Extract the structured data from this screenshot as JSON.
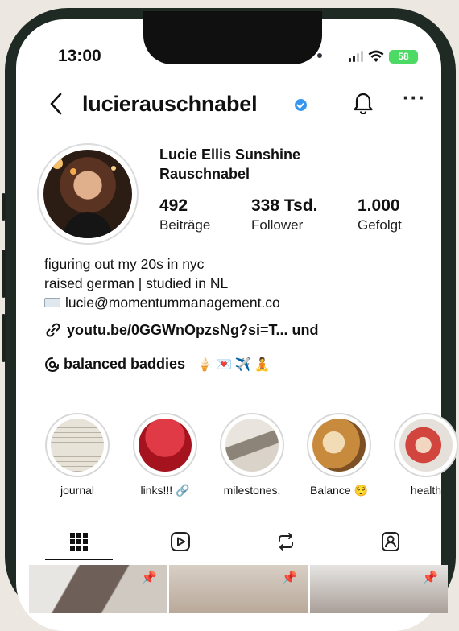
{
  "status_bar": {
    "time": "13:00",
    "battery": "58"
  },
  "header": {
    "username": "luciерauschnabel"
  },
  "profile": {
    "full_name": "Lucie Ellis Sunshine Rauschnabel",
    "stats": [
      {
        "value": "492",
        "label": "Beiträge"
      },
      {
        "value": "338 Tsd.",
        "label": "Follower"
      },
      {
        "value": "1.000",
        "label": "Gefolgt"
      }
    ],
    "bio": [
      "figuring out my 20s in nyc",
      "raised german | studied in NL",
      "lucie@momentummanagement.co"
    ],
    "link_text": "youtu.be/0GGWnOpzsNg?si=T... und",
    "thread_text": "balanced baddies",
    "thread_emojis": "🍦💌✈️🧘"
  },
  "highlights": [
    {
      "label": "journal",
      "color": "#cfcbbf"
    },
    {
      "label": "links!!! 🔗",
      "color": "#c8202c"
    },
    {
      "label": "milestones.",
      "color": "#c9c3ba"
    },
    {
      "label": "Balance 😌",
      "color": "#d3a25a"
    },
    {
      "label": "health",
      "color": "#c9514b"
    }
  ],
  "tabs": [
    "grid-icon",
    "reels-icon",
    "reposts-icon",
    "tagged-icon"
  ],
  "colors": {
    "accent_verified": "#3797f0",
    "frame": "#1f2a24",
    "battery": "#4cd964"
  }
}
